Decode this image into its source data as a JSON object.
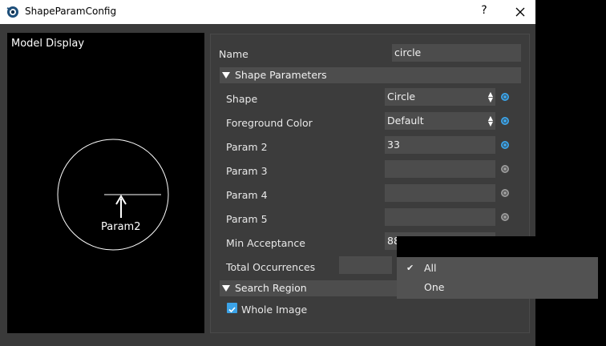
{
  "window": {
    "title": "ShapeParamConfig",
    "help": "?",
    "close": "×"
  },
  "model_display": {
    "label": "Model Display",
    "annotation": "Param2"
  },
  "props": {
    "name": {
      "label": "Name",
      "value": "circle"
    },
    "shape_section": "Shape Parameters",
    "shape": {
      "label": "Shape",
      "value": "Circle"
    },
    "fg_color": {
      "label": "Foreground Color",
      "value": "Default"
    },
    "param2": {
      "label": "Param 2",
      "value": "33"
    },
    "param3": {
      "label": "Param 3",
      "value": ""
    },
    "param4": {
      "label": "Param 4",
      "value": ""
    },
    "param5": {
      "label": "Param 5",
      "value": ""
    },
    "min_acceptance": {
      "label": "Min Acceptance",
      "value": "88"
    },
    "total_occurrences": {
      "label": "Total Occurrences",
      "value": ""
    },
    "search_section": "Search Region",
    "whole_image": {
      "label": "Whole Image",
      "checked": true
    }
  },
  "dropdown": {
    "items": [
      {
        "label": "All",
        "checked": true,
        "check": "✔"
      },
      {
        "label": "One",
        "checked": false,
        "check": ""
      }
    ]
  },
  "colors": {
    "accent": "#3ba3e8",
    "panel": "#3c3c3c",
    "field": "#4c4c4c"
  }
}
